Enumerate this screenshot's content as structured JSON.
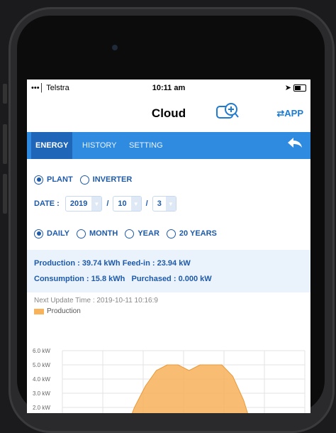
{
  "status": {
    "carrier": "•••│ Telstra",
    "time": "10:11 am",
    "right": "➤"
  },
  "header": {
    "title": "Cloud",
    "app_label": "⇄APP",
    "cloud_icon": "cloud-zoom-icon"
  },
  "tabs": [
    {
      "label": "ENERGY"
    },
    {
      "label": "HISTORY"
    },
    {
      "label": "SETTING"
    }
  ],
  "form": {
    "plant_label": "PLANT",
    "inverter_label": "INVERTER",
    "date_label": "DATE :",
    "year": "2019",
    "month": "10",
    "day": "3",
    "slash": "/",
    "periods": [
      "DAILY",
      "MONTH",
      "YEAR",
      "20 YEARS"
    ]
  },
  "info": {
    "production_label": "Production :",
    "production_value": "39.74 kWh",
    "feedin_label": "Feed-in :",
    "feedin_value": "23.94 kW",
    "consumption_label": "Consumption :",
    "consumption_value": "15.8 kWh",
    "purchased_label": "Purchased :",
    "purchased_value": "0.000 kW"
  },
  "update": "Next Update Time : 2019-10-11 10:16:9",
  "legend": "Production",
  "colors": {
    "accent": "#2f8be0",
    "production": "#f7b25a"
  },
  "chart_data": {
    "type": "area",
    "series": [
      {
        "name": "Production",
        "values": [
          0,
          0,
          0,
          0,
          2.0,
          3.5,
          4.6,
          5.0,
          5.0,
          4.6,
          5.0,
          5.0,
          5.0,
          4.2,
          2.5,
          0,
          0,
          0
        ]
      }
    ],
    "ytick_labels": [
      "6.0 kW",
      "5.0 kW",
      "4.0 kW",
      "3.0 kW",
      "2.0 kW"
    ],
    "ylim": [
      0,
      6
    ],
    "grid": true
  }
}
